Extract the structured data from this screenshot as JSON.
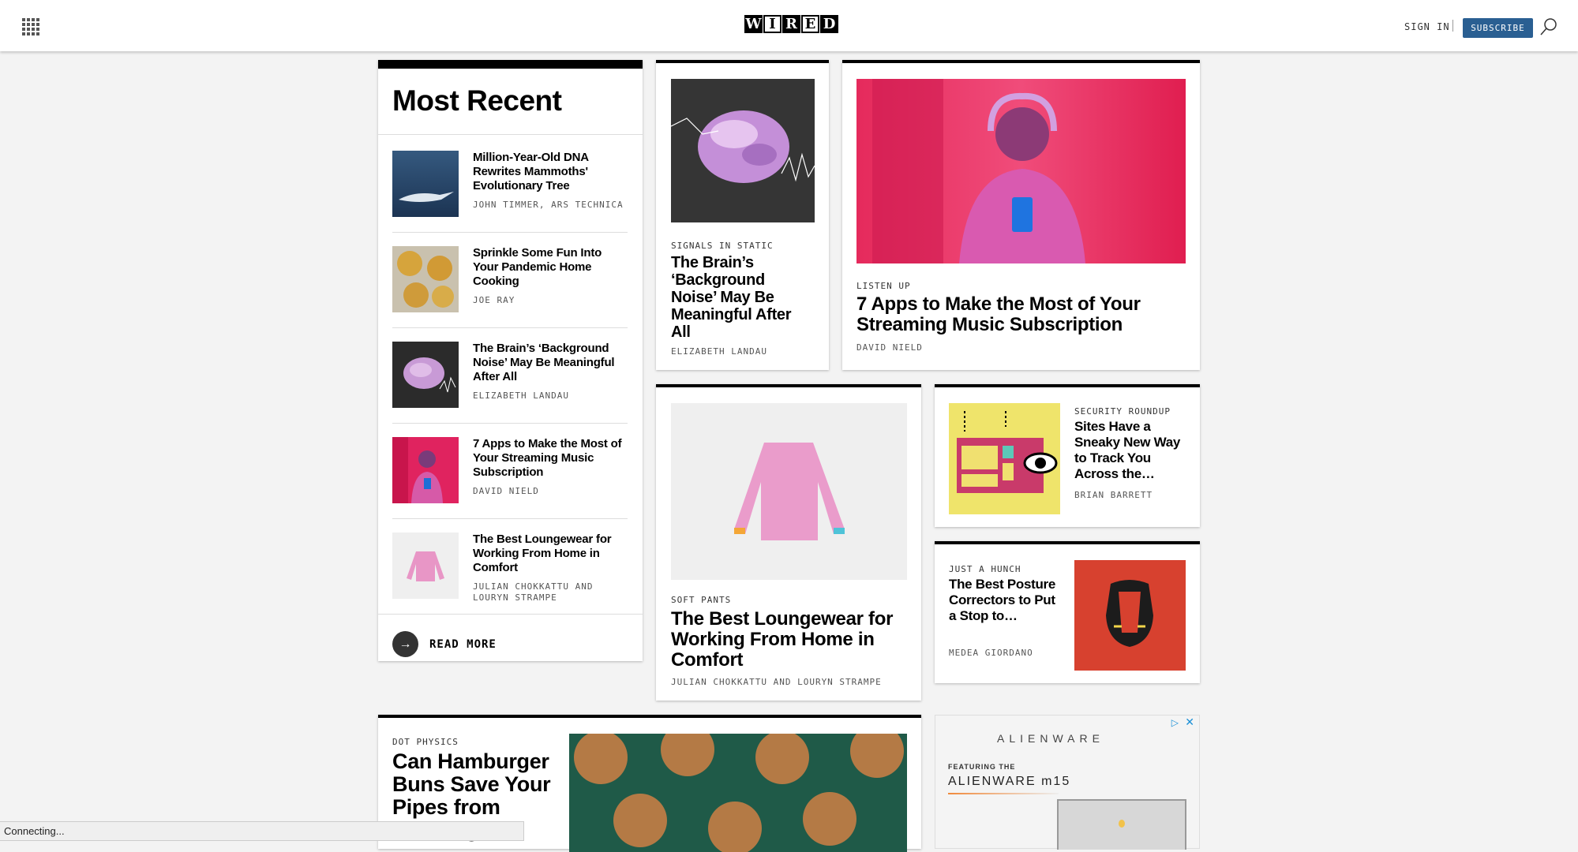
{
  "header": {
    "logo_letters": [
      "W",
      "I",
      "R",
      "E",
      "D"
    ],
    "sign_in": "SIGN IN",
    "subscribe": "SUBSCRIBE",
    "icons": {
      "menu": "grid-menu-icon",
      "search": "search-icon"
    }
  },
  "most_recent": {
    "title": "Most Recent",
    "items": [
      {
        "title": "Million-Year-Old DNA Rewrites Mammoths' Evolutionary Tree",
        "byline": "JOHN TIMMER, ARS TECHNICA"
      },
      {
        "title": "Sprinkle Some Fun Into Your Pandemic Home Cooking",
        "byline": "JOE RAY"
      },
      {
        "title": "The Brain’s ‘Background Noise’ May Be Meaningful After All",
        "byline": "ELIZABETH LANDAU"
      },
      {
        "title": "7 Apps to Make the Most of Your Streaming Music Subscription",
        "byline": "DAVID NIELD"
      },
      {
        "title": "The Best Loungewear for Working From Home in Comfort",
        "byline": "JULIAN CHOKKATTU AND LOURYN STRAMPE"
      }
    ],
    "read_more": "READ MORE"
  },
  "cards": {
    "brain": {
      "kicker": "SIGNALS IN STATIC",
      "title": "The Brain’s ‘Background Noise’ May Be Meaningful After All",
      "byline": "ELIZABETH LANDAU"
    },
    "music": {
      "kicker": "LISTEN UP",
      "title": "7 Apps to Make the Most of Your Streaming Music Subscription",
      "byline": "DAVID NIELD"
    },
    "lounge": {
      "kicker": "SOFT PANTS",
      "title": "The Best Loungewear for Working From Home in Comfort",
      "byline": "JULIAN CHOKKATTU AND LOURYN STRAMPE"
    },
    "security": {
      "kicker": "SECURITY ROUNDUP",
      "title": "Sites Have a Sneaky New Way to Track You Across the…",
      "byline": "BRIAN BARRETT"
    },
    "posture": {
      "kicker": "JUST A HUNCH",
      "title": "The Best Posture Correctors to Put a Stop to…",
      "byline": "MEDEA GIORDANO"
    },
    "buns": {
      "kicker": "DOT PHYSICS",
      "title": "Can Hamburger Buns Save Your Pipes from Freezing?"
    }
  },
  "ad": {
    "brand": "ALIENWARE",
    "featuring": "FEATURING THE",
    "model": "ALIENWARE m15"
  },
  "status_bar": "Connecting...",
  "colors": {
    "subscribe_bg": "#2a5f92",
    "accent_black": "#000000"
  }
}
